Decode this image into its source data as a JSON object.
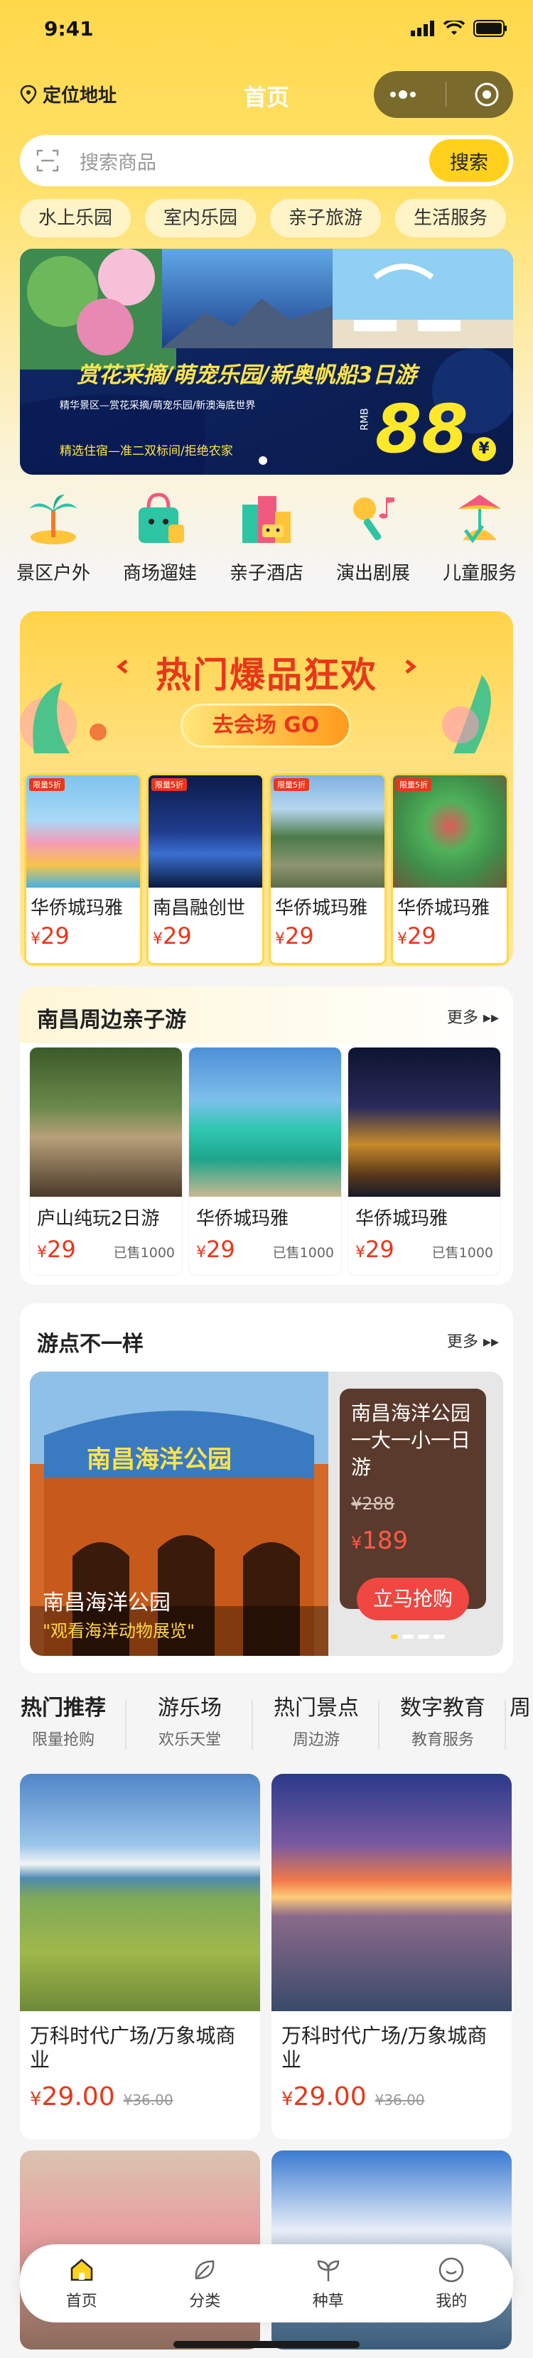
{
  "status": {
    "time": "9:41"
  },
  "nav": {
    "location": "定位地址",
    "title": "首页"
  },
  "search": {
    "placeholder": "搜索商品",
    "button": "搜索"
  },
  "chips": [
    "水上乐园",
    "室内乐园",
    "亲子旅游",
    "生活服务"
  ],
  "banner": {
    "headline": "赏花采摘/萌宠乐园/新奥帆船3日游",
    "line1": "精华景区—赏花采摘/萌宠乐园/新澳海底世界",
    "line2": "精选住宿—准二双标间/拒绝农家",
    "currency": "RMB",
    "price": "88",
    "unit": "¥"
  },
  "categories": [
    {
      "label": "景区户外",
      "icon": "palm-island-icon"
    },
    {
      "label": "商场遛娃",
      "icon": "shopping-bag-icon"
    },
    {
      "label": "亲子酒店",
      "icon": "hotel-icon"
    },
    {
      "label": "演出剧展",
      "icon": "microphone-icon"
    },
    {
      "label": "儿童服务",
      "icon": "playground-icon"
    }
  ],
  "hot": {
    "title": "热门爆品狂欢",
    "button": "去会场 GO",
    "products": [
      {
        "tag": "限量5折",
        "name": "华侨城玛雅",
        "currency": "¥",
        "price": "29"
      },
      {
        "tag": "限量5折",
        "name": "南昌融创世",
        "currency": "¥",
        "price": "29"
      },
      {
        "tag": "限量5折",
        "name": "华侨城玛雅",
        "currency": "¥",
        "price": "29"
      },
      {
        "tag": "限量5折",
        "name": "华侨城玛雅",
        "currency": "¥",
        "price": "29"
      }
    ]
  },
  "nearby": {
    "title": "南昌周边亲子游",
    "more": "更多",
    "items": [
      {
        "name": "庐山纯玩2日游",
        "currency": "¥",
        "price": "29",
        "sold": "已售1000"
      },
      {
        "name": "华侨城玛雅",
        "currency": "¥",
        "price": "29",
        "sold": "已售1000"
      },
      {
        "name": "华侨城玛雅",
        "currency": "¥",
        "price": "29",
        "sold": "已售1000"
      }
    ]
  },
  "diff": {
    "title": "游点不一样",
    "more": "更多",
    "park": "南昌海洋公园",
    "caption": "\"观看海洋动物展览\"",
    "card_title": "南昌海洋公园一大一小一日游",
    "orig": "¥288",
    "currency": "¥",
    "price": "189",
    "button": "立马抢购"
  },
  "tabs": [
    {
      "a": "热门推荐",
      "s": "限量抢购"
    },
    {
      "a": "游乐场",
      "s": "欢乐天堂"
    },
    {
      "a": "热门景点",
      "s": "周边游"
    },
    {
      "a": "数字教育",
      "s": "教育服务"
    },
    {
      "a": "周",
      "s": ""
    }
  ],
  "grid": [
    {
      "name": "万科时代广场/万象城商业",
      "currency": "¥",
      "price": "29.00",
      "orig": "¥36.00"
    },
    {
      "name": "万科时代广场/万象城商业",
      "currency": "¥",
      "price": "29.00",
      "orig": "¥36.00"
    }
  ],
  "tabbar": [
    {
      "label": "首页",
      "icon": "home-icon"
    },
    {
      "label": "分类",
      "icon": "leaf-icon"
    },
    {
      "label": "种草",
      "icon": "sprout-icon"
    },
    {
      "label": "我的",
      "icon": "user-icon"
    }
  ]
}
